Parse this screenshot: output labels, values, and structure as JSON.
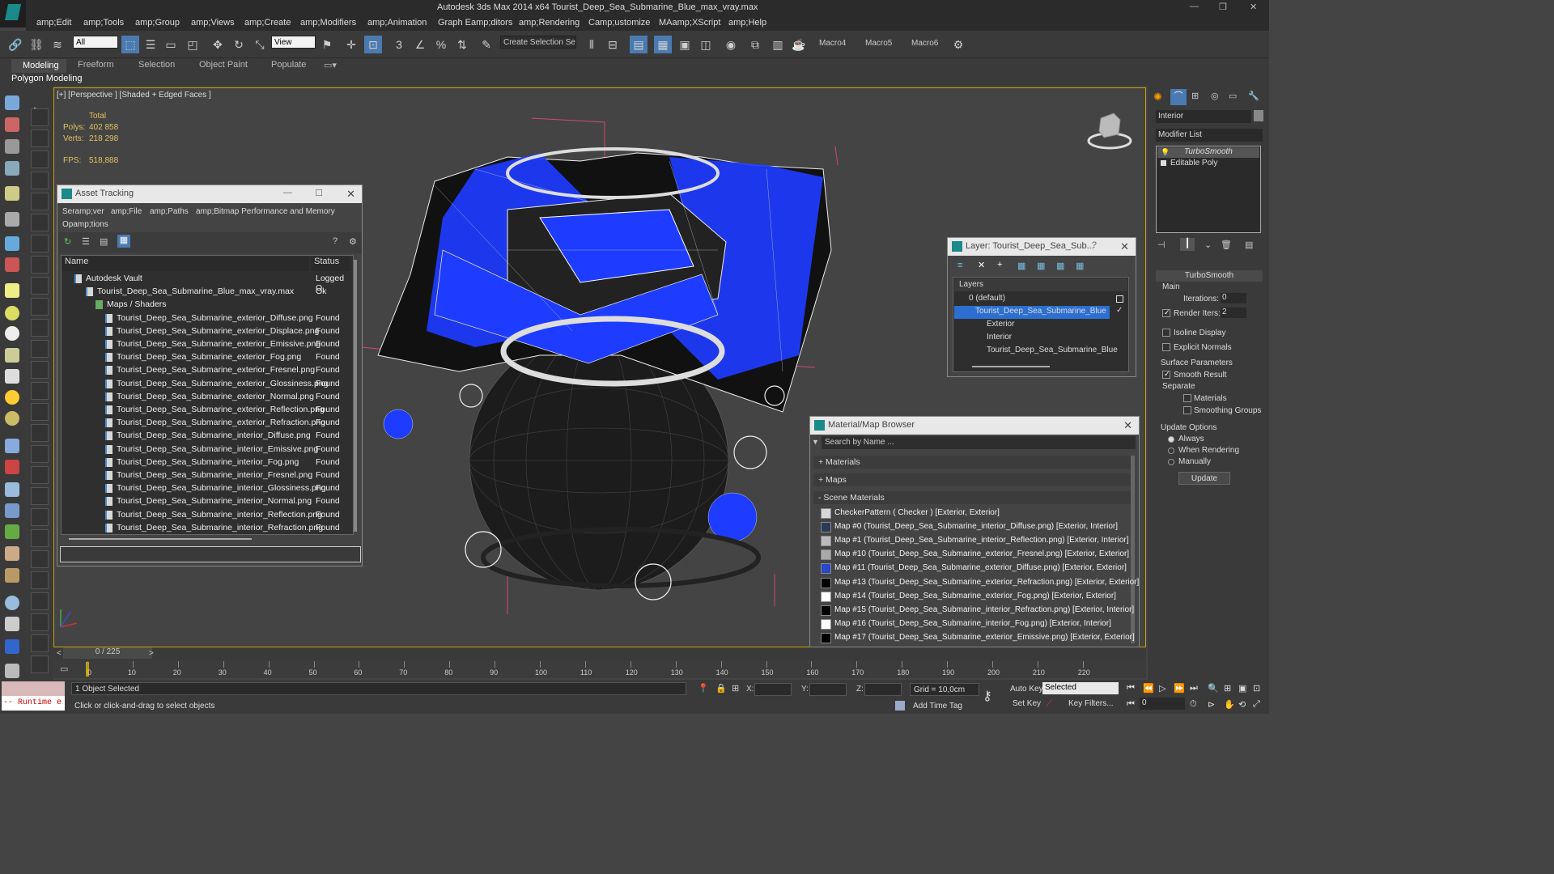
{
  "app": {
    "title": "Autodesk 3ds Max  2014 x64    Tourist_Deep_Sea_Submarine_Blue_max_vray.max"
  },
  "menu": [
    "amp;Edit",
    "amp;Tools",
    "amp;Group",
    "amp;Views",
    "amp;Create",
    "amp;Modifiers",
    "amp;Animation",
    "Graph Eamp;ditors",
    "amp;Rendering",
    "Camp;ustomize",
    "MAamp;XScript",
    "amp;Help"
  ],
  "toolbar": {
    "selection_filter": "All",
    "ref_coord": "View",
    "named_selection": "Create Selection Se",
    "macros": [
      "Macro4",
      "Macro5",
      "Macro6"
    ]
  },
  "ribbon": {
    "tabs": [
      "Modeling",
      "Freeform",
      "Selection",
      "Object Paint",
      "Populate"
    ],
    "panel": "Polygon Modeling"
  },
  "viewport": {
    "label": "[+] [Perspective ] [Shaded + Edged Faces ]",
    "stats": {
      "total": "Total",
      "polys_label": "Polys:",
      "polys": "402 858",
      "verts_label": "Verts:",
      "verts": "218 298",
      "fps_label": "FPS:",
      "fps": "518,888"
    }
  },
  "asset_tracking": {
    "title": "Asset Tracking",
    "menus": [
      "Seramp;ver",
      "amp;File",
      "amp;Paths",
      "amp;Bitmap Performance and Memory",
      "Opamp;tions"
    ],
    "columns": {
      "name": "Name",
      "status": "Status"
    },
    "rows": [
      {
        "name": "Autodesk Vault",
        "status": "Logged O"
      },
      {
        "name": "Tourist_Deep_Sea_Submarine_Blue_max_vray.max",
        "status": "Ok"
      },
      {
        "name": "Maps / Shaders",
        "status": ""
      },
      {
        "name": "Tourist_Deep_Sea_Submarine_exterior_Diffuse.png",
        "status": "Found"
      },
      {
        "name": "Tourist_Deep_Sea_Submarine_exterior_Displace.png",
        "status": "Found"
      },
      {
        "name": "Tourist_Deep_Sea_Submarine_exterior_Emissive.png",
        "status": "Found"
      },
      {
        "name": "Tourist_Deep_Sea_Submarine_exterior_Fog.png",
        "status": "Found"
      },
      {
        "name": "Tourist_Deep_Sea_Submarine_exterior_Fresnel.png",
        "status": "Found"
      },
      {
        "name": "Tourist_Deep_Sea_Submarine_exterior_Glossiness.png",
        "status": "Found"
      },
      {
        "name": "Tourist_Deep_Sea_Submarine_exterior_Normal.png",
        "status": "Found"
      },
      {
        "name": "Tourist_Deep_Sea_Submarine_exterior_Reflection.png",
        "status": "Found"
      },
      {
        "name": "Tourist_Deep_Sea_Submarine_exterior_Refraction.png",
        "status": "Found"
      },
      {
        "name": "Tourist_Deep_Sea_Submarine_interior_Diffuse.png",
        "status": "Found"
      },
      {
        "name": "Tourist_Deep_Sea_Submarine_interior_Emissive.png",
        "status": "Found"
      },
      {
        "name": "Tourist_Deep_Sea_Submarine_interior_Fog.png",
        "status": "Found"
      },
      {
        "name": "Tourist_Deep_Sea_Submarine_interior_Fresnel.png",
        "status": "Found"
      },
      {
        "name": "Tourist_Deep_Sea_Submarine_interior_Glossiness.png",
        "status": "Found"
      },
      {
        "name": "Tourist_Deep_Sea_Submarine_interior_Normal.png",
        "status": "Found"
      },
      {
        "name": "Tourist_Deep_Sea_Submarine_interior_Reflection.png",
        "status": "Found"
      },
      {
        "name": "Tourist_Deep_Sea_Submarine_interior_Refraction.png",
        "status": "Found"
      }
    ]
  },
  "layer": {
    "title": "Layer: Tourist_Deep_Sea_Sub...",
    "header": "Layers",
    "rows": [
      "0 (default)",
      "Tourist_Deep_Sea_Submarine_Blue",
      "Exterior",
      "Interior",
      "Tourist_Deep_Sea_Submarine_Blue"
    ]
  },
  "material_browser": {
    "title": "Material/Map Browser",
    "search_placeholder": "Search by Name ...",
    "sections": [
      "+ Materials",
      "+ Maps",
      "- Scene Materials"
    ],
    "items": [
      {
        "label": "CheckerPattern  ( Checker ) [Exterior, Exterior]",
        "swatch": "#d8d8d8"
      },
      {
        "label": "Map #0 (Tourist_Deep_Sea_Submarine_interior_Diffuse.png) [Exterior, Interior]",
        "swatch": "#2c3a5a"
      },
      {
        "label": "Map #1 (Tourist_Deep_Sea_Submarine_interior_Reflection.png) [Exterior, Interior]",
        "swatch": "#bbbbbb"
      },
      {
        "label": "Map #10 (Tourist_Deep_Sea_Submarine_exterior_Fresnel.png) [Exterior, Exterior]",
        "swatch": "#aaaaaa"
      },
      {
        "label": "Map #11 (Tourist_Deep_Sea_Submarine_exterior_Diffuse.png) [Exterior, Exterior]",
        "swatch": "#2848c8"
      },
      {
        "label": "Map #13 (Tourist_Deep_Sea_Submarine_exterior_Refraction.png) [Exterior, Exterior]",
        "swatch": "#000000"
      },
      {
        "label": "Map #14 (Tourist_Deep_Sea_Submarine_exterior_Fog.png) [Exterior, Exterior]",
        "swatch": "#ffffff"
      },
      {
        "label": "Map #15 (Tourist_Deep_Sea_Submarine_interior_Refraction.png) [Exterior, Interior]",
        "swatch": "#000000"
      },
      {
        "label": "Map #16 (Tourist_Deep_Sea_Submarine_interior_Fog.png) [Exterior, Interior]",
        "swatch": "#ffffff"
      },
      {
        "label": "Map #17 (Tourist_Deep_Sea_Submarine_exterior_Emissive.png) [Exterior, Exterior]",
        "swatch": "#000000"
      }
    ]
  },
  "command_panel": {
    "object_name": "Interior",
    "modifier_list": "Modifier List",
    "stack": [
      "TurboSmooth",
      "Editable Poly"
    ],
    "rollout": "TurboSmooth",
    "main": "Main",
    "iterations_label": "Iterations:",
    "iterations": "0",
    "render_iters_label": "Render Iters:",
    "render_iters": "2",
    "isoline": "Isoline Display",
    "explicit": "Explicit Normals",
    "surface": "Surface Parameters",
    "smooth_result": "Smooth Result",
    "separate": "Separate",
    "materials": "Materials",
    "smoothing_groups": "Smoothing Groups",
    "update_options": "Update Options",
    "always": "Always",
    "when_rendering": "When Rendering",
    "manually": "Manually",
    "update": "Update"
  },
  "timeline": {
    "counter": "0 / 225",
    "ticks": [
      "0",
      "10",
      "20",
      "30",
      "40",
      "50",
      "60",
      "70",
      "80",
      "90",
      "100",
      "110",
      "120",
      "130",
      "140",
      "150",
      "160",
      "170",
      "180",
      "190",
      "200",
      "210",
      "220"
    ]
  },
  "status": {
    "maxscript": "-- Runtime e",
    "selected": "1 Object Selected",
    "prompt": "Click or click-and-drag to select objects",
    "x_label": "X:",
    "y_label": "Y:",
    "z_label": "Z:",
    "grid": "Grid = 10,0cm",
    "add_time_tag": "Add Time Tag",
    "auto_key": "Auto Key",
    "set_key": "Set Key",
    "key_mode": "Selected",
    "key_filters": "Key Filters...",
    "frame": "0"
  },
  "colors": {
    "accent": "#c9a000",
    "selection_blue": "#2c6fd1",
    "hull_blue": "#1e3cff"
  }
}
